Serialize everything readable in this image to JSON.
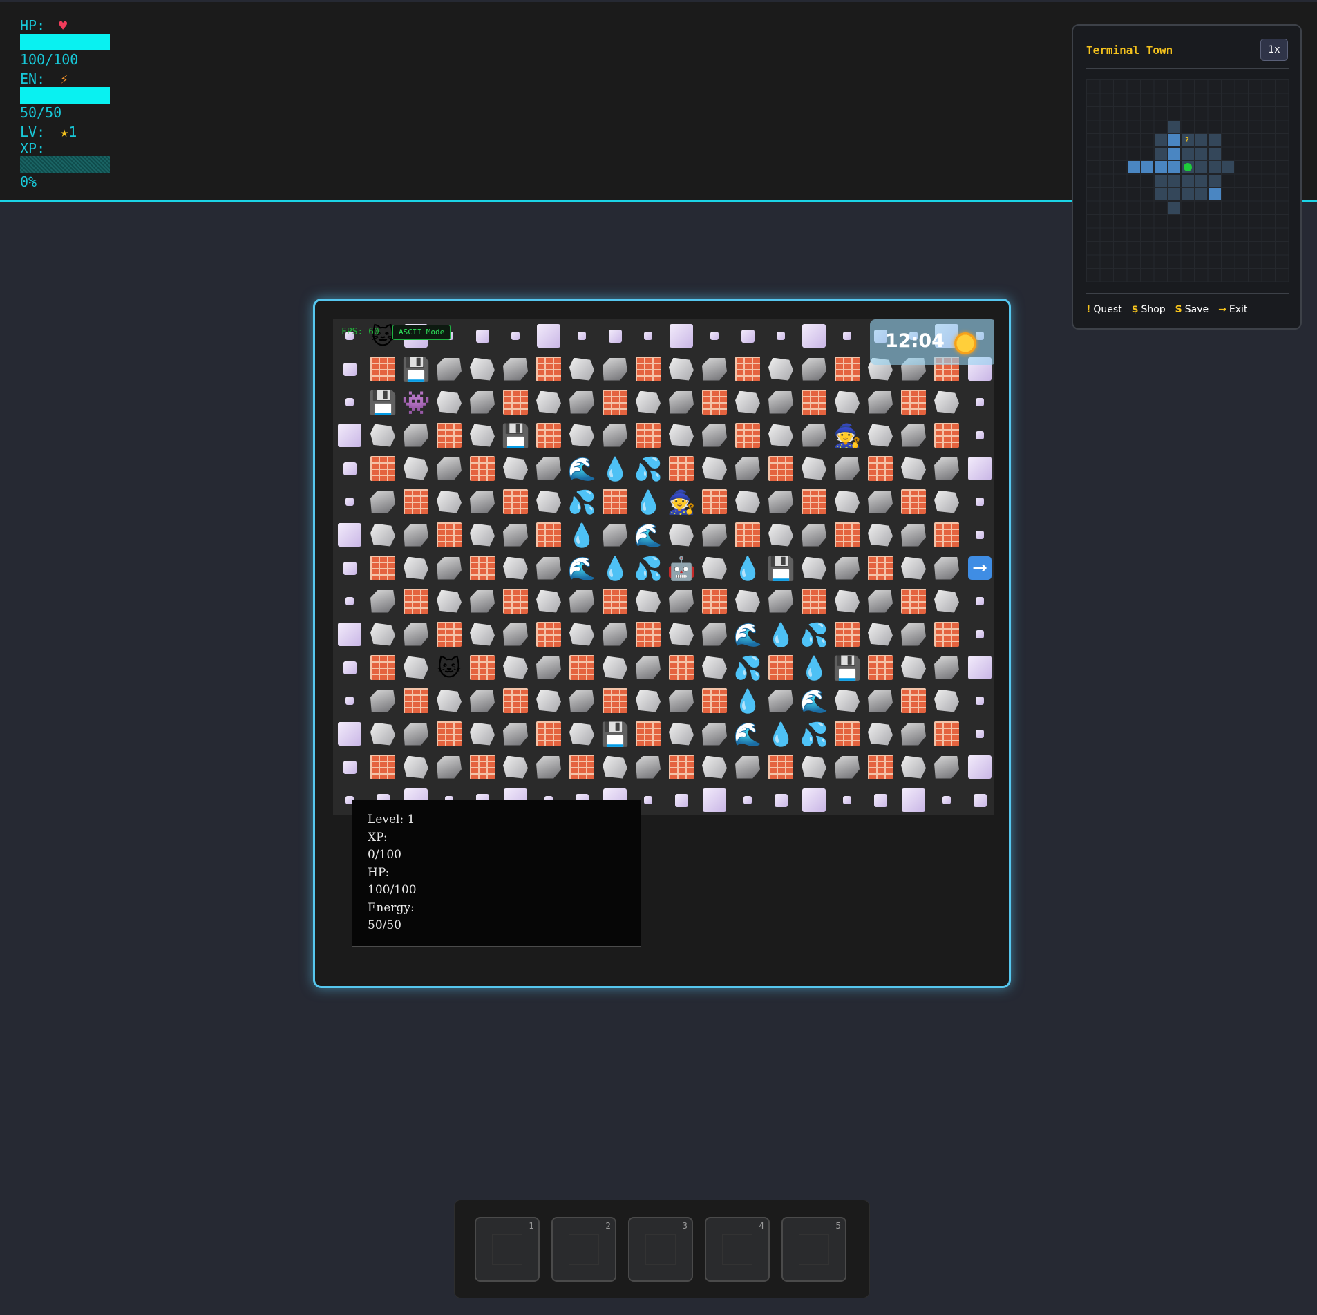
{
  "hud": {
    "hp_label": "HP:",
    "hp_value": "100/100",
    "hp_fraction": 1.0,
    "en_label": "EN:",
    "en_value": "50/50",
    "en_fraction": 1.0,
    "lv_label": "LV:",
    "lv_value": "1",
    "xp_label": "XP:",
    "xp_value": "0%",
    "xp_fraction": 0.0,
    "icons": {
      "hp": "heart-icon",
      "en": "lightning-icon",
      "lv": "star-icon"
    },
    "colors": {
      "accent": "#1bd3e6",
      "bar": "#09f1f1"
    }
  },
  "minimap": {
    "title": "Terminal Town",
    "zoom": "1x",
    "quest_marker": "?",
    "legend": [
      {
        "symbol": "!",
        "label": "Quest"
      },
      {
        "symbol": "$",
        "label": "Shop"
      },
      {
        "symbol": "S",
        "label": "Save"
      },
      {
        "symbol": "→",
        "label": "Exit"
      }
    ]
  },
  "game": {
    "fps_text": "FPS: 60",
    "ascii_button": "ASCII Mode",
    "clock": "12:04",
    "time_icon": "sun-icon",
    "tile_legend": {
      "B": "brick-wall",
      "r": "rock",
      "R": "rock-alt",
      "s": "floppy-disk",
      "w": "water-wave",
      "d": "water-drop",
      "p": "water-splash",
      "g": "alien-monster",
      "m": "mage-npc",
      "c": "cat-npc",
      "o": "robot-player",
      "x": "exit-arrow"
    },
    "map": [
      "scLsmsLsmsLsmsLsmsLs",
      "mBsRrRBrRBrRBrRBrRBL",
      "ssgrRBrRBrRBrRBrRBrs",
      "LrRBrsBrRBrRBrRmrRBs",
      "mBrRBrRwdpBrRBrRBrRL",
      "sRBrRBrpBdmBrRBrRBrs",
      "LrRBrRBdRwrRBrRBrRBs",
      "mBrRBrRwdpordsrRBrRx",
      "sRBrRBrRBrRBrRBrRBrs",
      "LrRBrRBrRBrRwdpBrRBs",
      "mBrcBrRBrRBrpBdsBrRL",
      "sRBrRBrRBrRBdRwrRBrs",
      "LrRBrRBrsBrRwdpBrRBs",
      "mBrRBrRBrRBrRBrRBrRL",
      "smLsmLsmLsmLsmLsmLsm"
    ]
  },
  "character": {
    "level_label": "Level:",
    "level_value": "1",
    "xp_label": "XP:",
    "xp_value": "0/100",
    "hp_label": "HP:",
    "hp_value": "100/100",
    "energy_label": "Energy:",
    "energy_value": "50/50"
  },
  "hotbar": {
    "slots": [
      {
        "number": "1"
      },
      {
        "number": "2"
      },
      {
        "number": "3"
      },
      {
        "number": "4"
      },
      {
        "number": "5"
      }
    ]
  }
}
